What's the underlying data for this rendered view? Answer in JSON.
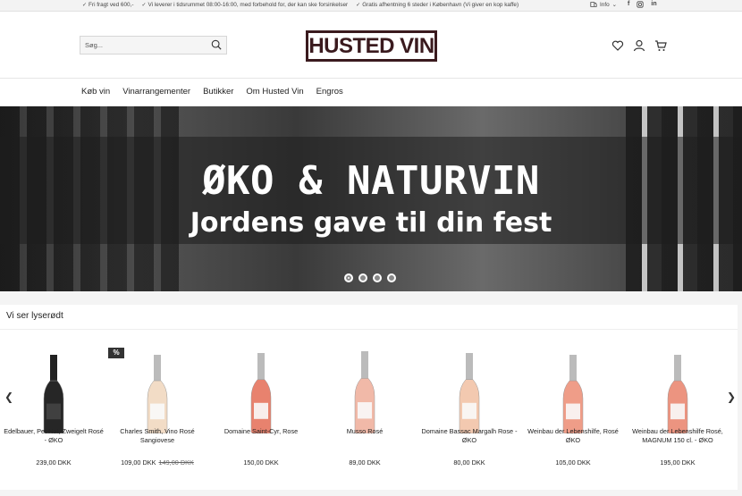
{
  "topbar": {
    "usps": [
      "Fri fragt ved 600,-",
      "Vi leverer i tidsrummet 08:00-16:00, med forbehold for, der kan ske forsinkelser",
      "Gratis afhentning 6 steder i København (Vi giver en kop kaffe)"
    ],
    "info_label": "Info"
  },
  "header": {
    "search_placeholder": "Søg...",
    "logo_text": "HUSTED VIN"
  },
  "nav": {
    "items": [
      "Køb vin",
      "Vinarrangementer",
      "Butikker",
      "Om Husted Vin",
      "Engros"
    ]
  },
  "hero": {
    "headline": "ØKO & NATURVIN",
    "subheadline": "Jordens gave til din fest",
    "slides": 4,
    "active_slide": 1
  },
  "products": {
    "section_title": "Vi ser lyserødt",
    "sale_badge": "%",
    "items": [
      {
        "name": "Edelbauer, Pet Nat, Zweigelt Rosé - ØKO",
        "price": "239,00 DKK",
        "old_price": "",
        "color": "#262626"
      },
      {
        "name": "Charles Smith, Vino Rosé Sangiovese",
        "price": "109,00 DKK",
        "old_price": "149,00 DKK",
        "color": "#f2dcc6"
      },
      {
        "name": "Domaine Saint-Cyr, Rose",
        "price": "150,00 DKK",
        "old_price": "",
        "color": "#e8826e"
      },
      {
        "name": "Musso Rosé",
        "price": "89,00 DKK",
        "old_price": "",
        "color": "#f1b9a8"
      },
      {
        "name": "Domaine Bassac Margalh Rose - ØKO",
        "price": "80,00 DKK",
        "old_price": "",
        "color": "#f3c9b0"
      },
      {
        "name": "Weinbau der Lebenshilfe, Rosé ØKO",
        "price": "105,00 DKK",
        "old_price": "",
        "color": "#ef9d88"
      },
      {
        "name": "Weinbau der Lebenshilfe Rosé, MAGNUM 150 cl. - ØKO",
        "price": "195,00 DKK",
        "old_price": "",
        "color": "#ec9480"
      }
    ]
  }
}
